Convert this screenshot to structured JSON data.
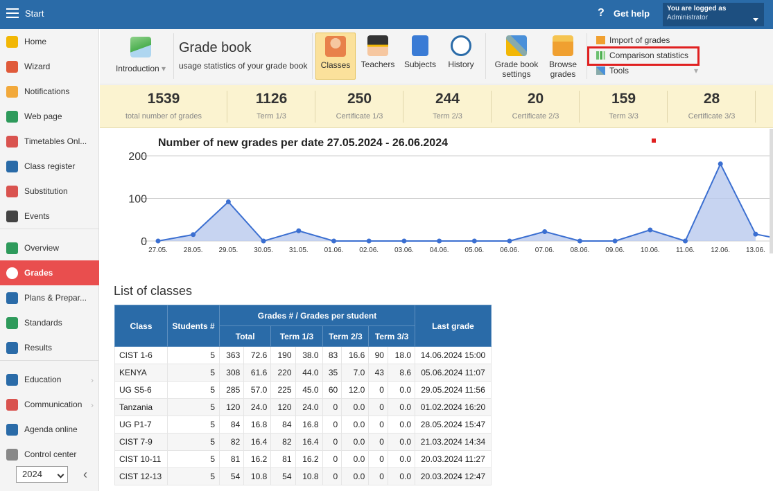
{
  "topbar": {
    "title": "Start",
    "help": "Get help",
    "help_icon": "?",
    "logged_label": "You are logged as",
    "user": "Administrator"
  },
  "sidebar": {
    "items": [
      {
        "label": "Home",
        "icon": "star-icon",
        "color": "#f2b705"
      },
      {
        "label": "Wizard",
        "icon": "wizard-icon",
        "color": "#e05a3a"
      },
      {
        "label": "Notifications",
        "icon": "envelope-icon",
        "color": "#f2a93b"
      },
      {
        "label": "Web page",
        "icon": "house-icon",
        "color": "#2e9a5b"
      },
      {
        "label": "Timetables Onl...",
        "icon": "timetable-icon",
        "color": "#d9534f"
      },
      {
        "label": "Class register",
        "icon": "book-icon",
        "color": "#2a6ba8"
      },
      {
        "label": "Substitution",
        "icon": "person-icon",
        "color": "#d9534f"
      },
      {
        "label": "Events",
        "icon": "calendar-icon",
        "color": "#444444"
      },
      {
        "label": "Overview",
        "icon": "check-circle-icon",
        "color": "#2e9a5b"
      },
      {
        "label": "Grades",
        "icon": "grade-icon",
        "color": "#ffffff"
      },
      {
        "label": "Plans & Prepar...",
        "icon": "plans-icon",
        "color": "#2a6ba8"
      },
      {
        "label": "Standards",
        "icon": "shield-check-icon",
        "color": "#2e9a5b"
      },
      {
        "label": "Results",
        "icon": "bar-chart-icon",
        "color": "#2a6ba8"
      },
      {
        "label": "Education",
        "icon": "education-icon",
        "color": "#2a6ba8"
      },
      {
        "label": "Communication",
        "icon": "chat-icon",
        "color": "#d9534f"
      },
      {
        "label": "Agenda online",
        "icon": "pen-icon",
        "color": "#2a6ba8"
      },
      {
        "label": "Control center",
        "icon": "gear-icon",
        "color": "#888888"
      }
    ],
    "year": "2024"
  },
  "ribbon": {
    "introduction": "Introduction",
    "title": "Grade book",
    "subtitle": "usage statistics of your grade book",
    "buttons": [
      {
        "label": "Classes"
      },
      {
        "label": "Teachers"
      },
      {
        "label": "Subjects"
      },
      {
        "label": "History"
      },
      {
        "label": "Grade book settings"
      },
      {
        "label": "Browse grades"
      }
    ],
    "menu": {
      "import": "Import of grades",
      "comparison": "Comparison statistics",
      "tools": "Tools"
    }
  },
  "stats": [
    {
      "value": "1539",
      "label": "total number of grades"
    },
    {
      "value": "1126",
      "label": "Term 1/3"
    },
    {
      "value": "250",
      "label": "Certificate 1/3"
    },
    {
      "value": "244",
      "label": "Term 2/3"
    },
    {
      "value": "20",
      "label": "Certificate 2/3"
    },
    {
      "value": "159",
      "label": "Term 3/3"
    },
    {
      "value": "28",
      "label": "Certificate 3/3"
    }
  ],
  "chart_data": {
    "type": "area",
    "title": "Number of new grades per date 27.05.2024 - 26.06.2024",
    "ylim": [
      0,
      200
    ],
    "yticks": [
      "200",
      "100",
      "0"
    ],
    "categories": [
      "27.05.",
      "28.05.",
      "29.05.",
      "30.05.",
      "31.05.",
      "01.06.",
      "02.06.",
      "03.06.",
      "04.06.",
      "05.06.",
      "06.06.",
      "07.06.",
      "08.06.",
      "09.06.",
      "10.06.",
      "11.06.",
      "12.06.",
      "13.06."
    ],
    "values": [
      0,
      15,
      92,
      0,
      24,
      0,
      0,
      0,
      0,
      0,
      0,
      22,
      0,
      0,
      26,
      0,
      181,
      16
    ],
    "color": "#3b6fd1",
    "fill": "#b9c9ee"
  },
  "list": {
    "title": "List of classes",
    "headers": {
      "class": "Class",
      "students": "Students #",
      "grades": "Grades # / Grades per student",
      "total": "Total",
      "t1": "Term 1/3",
      "t2": "Term 2/3",
      "t3": "Term 3/3",
      "last": "Last grade"
    },
    "rows": [
      [
        "CIST 1-6",
        "5",
        "363",
        "72.6",
        "190",
        "38.0",
        "83",
        "16.6",
        "90",
        "18.0",
        "14.06.2024 15:00"
      ],
      [
        "KENYA",
        "5",
        "308",
        "61.6",
        "220",
        "44.0",
        "35",
        "7.0",
        "43",
        "8.6",
        "05.06.2024 11:07"
      ],
      [
        "UG S5-6",
        "5",
        "285",
        "57.0",
        "225",
        "45.0",
        "60",
        "12.0",
        "0",
        "0.0",
        "29.05.2024 11:56"
      ],
      [
        "Tanzania",
        "5",
        "120",
        "24.0",
        "120",
        "24.0",
        "0",
        "0.0",
        "0",
        "0.0",
        "01.02.2024 16:20"
      ],
      [
        "UG P1-7",
        "5",
        "84",
        "16.8",
        "84",
        "16.8",
        "0",
        "0.0",
        "0",
        "0.0",
        "28.05.2024 15:47"
      ],
      [
        "CIST 7-9",
        "5",
        "82",
        "16.4",
        "82",
        "16.4",
        "0",
        "0.0",
        "0",
        "0.0",
        "21.03.2024 14:34"
      ],
      [
        "CIST 10-11",
        "5",
        "81",
        "16.2",
        "81",
        "16.2",
        "0",
        "0.0",
        "0",
        "0.0",
        "20.03.2024 11:27"
      ],
      [
        "CIST 12-13",
        "5",
        "54",
        "10.8",
        "54",
        "10.8",
        "0",
        "0.0",
        "0",
        "0.0",
        "20.03.2024 12:47"
      ]
    ]
  }
}
